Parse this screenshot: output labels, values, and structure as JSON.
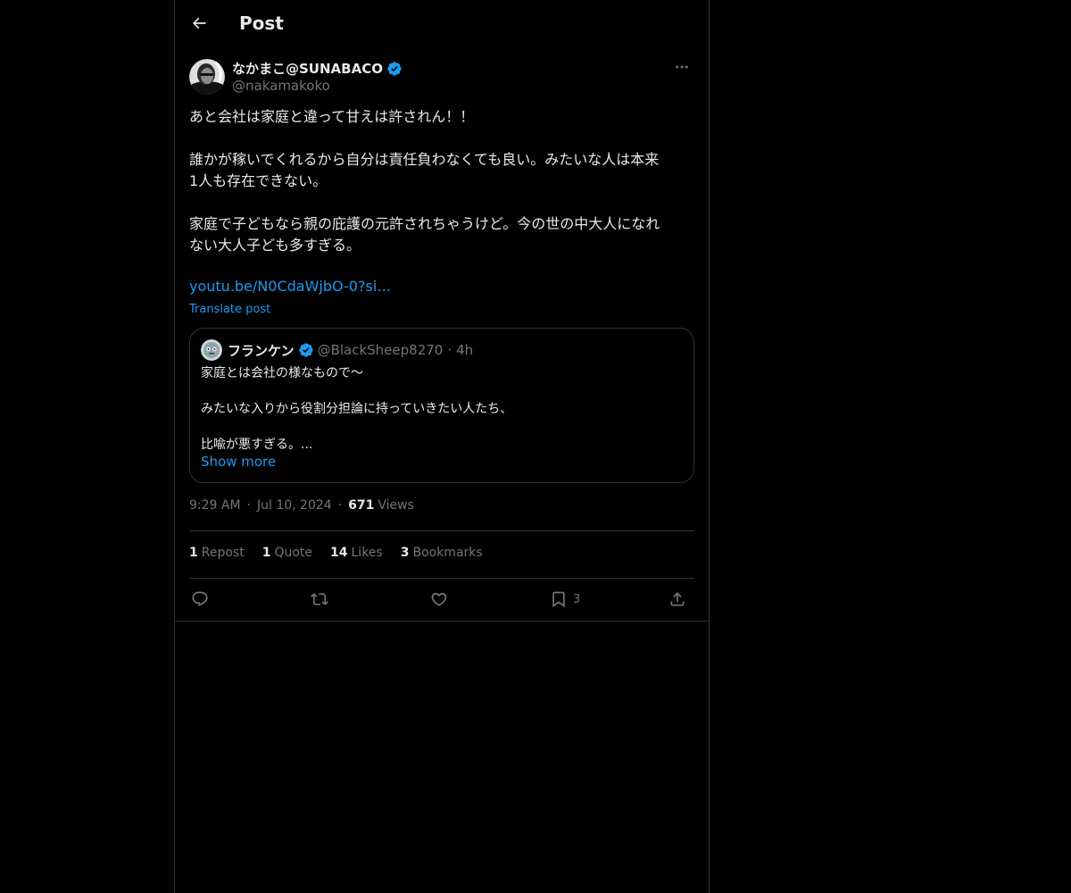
{
  "header": {
    "title": "Post"
  },
  "author": {
    "name": "なかまこ@SUNABACO",
    "handle": "@nakamakoko"
  },
  "post": {
    "paragraphs": [
      [
        "あと会社は家庭と違って甘えは許されん！！"
      ],
      [
        "誰かが稼いでくれるから自分は責任負わなくても良い。みたいな人は本来",
        "1人も存在できない。"
      ],
      [
        "家庭で子どもなら親の庇護の元許されちゃうけど。今の世の中大人になれ",
        "ない大人子ども多すぎる。"
      ]
    ],
    "link": "youtu.be/N0CdaWjbO-0?si…",
    "translate_label": "Translate post"
  },
  "quote": {
    "name": "フランケン",
    "handle": "@BlackSheep8270",
    "time": "4h",
    "lines": [
      "家庭とは会社の様なもので〜",
      "",
      "みたいな入りから役割分担論に持っていきたい人たち、",
      "",
      "比喩が悪すぎる。..."
    ],
    "show_more": "Show more"
  },
  "meta": {
    "time": "9:29 AM",
    "date": "Jul 10, 2024",
    "views_count": "671",
    "views_label": "Views"
  },
  "stats": {
    "reposts": {
      "count": "1",
      "label": "Repost"
    },
    "quotes": {
      "count": "1",
      "label": "Quote"
    },
    "likes": {
      "count": "14",
      "label": "Likes"
    },
    "bookmarks": {
      "count": "3",
      "label": "Bookmarks"
    }
  },
  "actions": {
    "bookmark_count": "3"
  },
  "colors": {
    "background": "#000000",
    "text": "#e7e9ea",
    "muted": "#71767b",
    "accent": "#1d9bf0",
    "border": "#2f3336"
  },
  "icons": [
    "back-arrow-icon",
    "verified-badge-icon",
    "more-icon",
    "reply-icon",
    "repost-icon",
    "like-icon",
    "bookmark-icon",
    "share-icon"
  ]
}
